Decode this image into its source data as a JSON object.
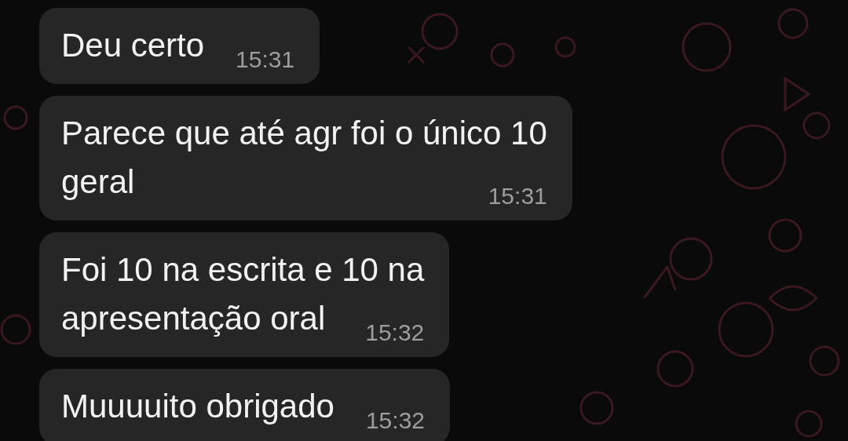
{
  "messages": [
    {
      "lines": [
        "Deu certo"
      ],
      "time": "15:31"
    },
    {
      "lines": [
        "Parece que até agr foi o único 10",
        "geral"
      ],
      "time": "15:31"
    },
    {
      "lines": [
        "Foi 10 na escrita e 10 na",
        "apresentação oral"
      ],
      "time": "15:32"
    },
    {
      "lines": [
        "Muuuuito obrigado"
      ],
      "time": "15:32"
    }
  ]
}
